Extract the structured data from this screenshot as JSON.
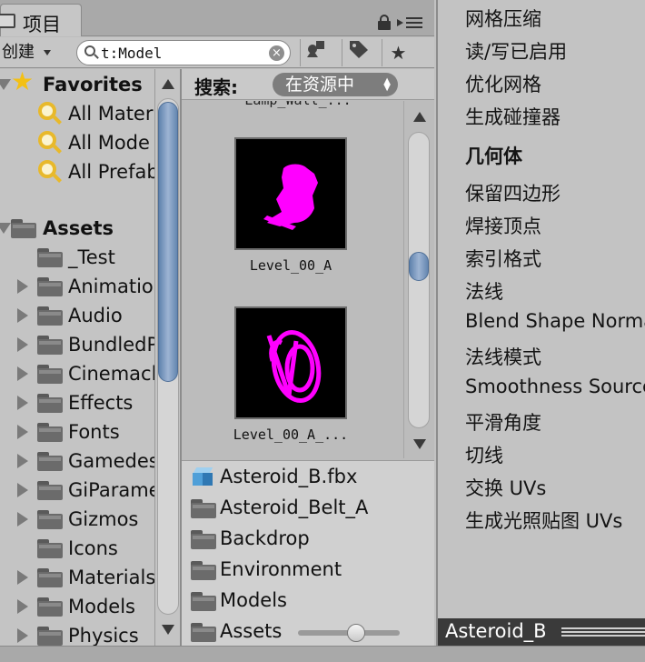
{
  "project_tab": {
    "title": "项目"
  },
  "toolbar": {
    "create_label": "创建",
    "search_value": "t:Model",
    "clear_glyph": "×",
    "tool_icons": [
      "filter-by-type-icon",
      "filter-by-label-icon",
      "favorites-star-icon"
    ]
  },
  "tree": {
    "favorites": {
      "label": "Favorites",
      "items": [
        "All Mater",
        "All Mode",
        "All Prefab"
      ]
    },
    "assets": {
      "label": "Assets",
      "items": [
        {
          "label": "_Test",
          "expandable": false
        },
        {
          "label": "Animatio",
          "expandable": true
        },
        {
          "label": "Audio",
          "expandable": true
        },
        {
          "label": "BundledP",
          "expandable": true
        },
        {
          "label": "Cinemacl",
          "expandable": true
        },
        {
          "label": "Effects",
          "expandable": true
        },
        {
          "label": "Fonts",
          "expandable": true
        },
        {
          "label": "Gamedes",
          "expandable": true
        },
        {
          "label": "GiParame",
          "expandable": true
        },
        {
          "label": "Gizmos",
          "expandable": true
        },
        {
          "label": "Icons",
          "expandable": false
        },
        {
          "label": "Materials",
          "expandable": true
        },
        {
          "label": "Models",
          "expandable": true
        },
        {
          "label": "Physics",
          "expandable": true
        }
      ]
    }
  },
  "asset_panel": {
    "search_label": "搜索:",
    "scope": "在资源中",
    "cut_label": "Lamp_Wall_...",
    "thumbnails": [
      {
        "label": "Level_00_A"
      },
      {
        "label": "Level_00_A_..."
      }
    ],
    "preview_color": "#ff00ff",
    "list": [
      {
        "label": "Asteroid_B.fbx",
        "icon": "mesh-icon"
      },
      {
        "label": "Asteroid_Belt_A",
        "icon": "folder-icon"
      },
      {
        "label": "Backdrop",
        "icon": "folder-icon"
      },
      {
        "label": "Environment",
        "icon": "folder-icon"
      },
      {
        "label": "Models",
        "icon": "folder-icon"
      },
      {
        "label": "Assets",
        "icon": "folder-icon"
      }
    ]
  },
  "inspector": {
    "rows": [
      {
        "label": "网格压缩",
        "bold": false
      },
      {
        "label": "读/写已启用",
        "bold": false
      },
      {
        "label": "优化网格",
        "bold": false
      },
      {
        "label": "生成碰撞器",
        "bold": false
      },
      {
        "label": "几何体",
        "bold": true
      },
      {
        "label": "保留四边形",
        "bold": false
      },
      {
        "label": "焊接顶点",
        "bold": false
      },
      {
        "label": "索引格式",
        "bold": false
      },
      {
        "label": "法线",
        "bold": false
      },
      {
        "label": "Blend Shape Norma",
        "bold": false
      },
      {
        "label": "法线模式",
        "bold": false
      },
      {
        "label": "Smoothness Source",
        "bold": false
      },
      {
        "label": "平滑角度",
        "bold": false
      },
      {
        "label": "切线",
        "bold": false
      },
      {
        "label": "交换 UVs",
        "bold": false
      },
      {
        "label": "生成光照贴图 UVs",
        "bold": false
      }
    ],
    "preview_title": "Asteroid_B"
  }
}
